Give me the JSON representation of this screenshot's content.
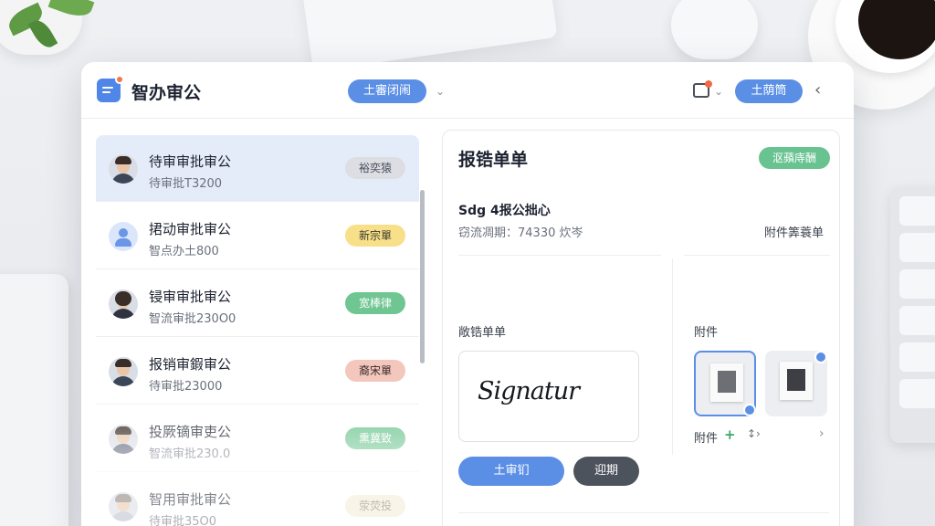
{
  "app": {
    "title": "智办审公",
    "header_pill": "土審闭闹",
    "action_button": "土荫筒"
  },
  "list": {
    "items": [
      {
        "title": "待审审批审公",
        "subtitle": "待审批T3200",
        "tag": "裕奕猿",
        "tag_bg": "#dcdee3",
        "tag_fg": "#4a505c",
        "avatar": "person-male-1"
      },
      {
        "title": "捃动审批审公",
        "subtitle": "智点办土800",
        "tag": "新宗單",
        "tag_bg": "#f8e08a",
        "tag_fg": "#3a3a2a",
        "avatar": "generic-user"
      },
      {
        "title": "锓审审批审公",
        "subtitle": "智流审批230O0",
        "tag": "宽棒律",
        "tag_bg": "#6fc692",
        "tag_fg": "#ffffff",
        "avatar": "person-female"
      },
      {
        "title": "报销审鍜审公",
        "subtitle": "待审批23000",
        "tag": "裔宋單",
        "tag_bg": "#f4c7bd",
        "tag_fg": "#3a2a2a",
        "avatar": "person-male-2"
      },
      {
        "title": "投厥镝审吏公",
        "subtitle": "智流审批230.0",
        "tag": "熏冀致",
        "tag_bg": "#6fc692",
        "tag_fg": "#ffffff",
        "avatar": "person-male-3"
      },
      {
        "title": "智用审批审公",
        "subtitle": "待审批35O0",
        "tag": "荥荧投",
        "tag_bg": "#f3ecd7",
        "tag_fg": "#8a8470",
        "avatar": "person-male-4"
      }
    ]
  },
  "detail": {
    "title": "报锆单单",
    "status": "沤蘋庤酬",
    "meta_line1": "Sdg 4报公拙心",
    "meta_line2": "窃流凋期：74330  炊岑",
    "meta_right": "附件筭蓑单",
    "signature_label": "敞锆单单",
    "signature_text": "Signatur",
    "attachments_label": "附件",
    "attachments_caption": "附件",
    "primary_button": "土审钔",
    "secondary_button": "迎期"
  },
  "icons": {
    "app": "app-icon",
    "notification": "bell-icon",
    "close": "close-icon"
  },
  "colors": {
    "accent": "#5b8fe6",
    "success": "#69c391",
    "active_row": "#e5ecf9"
  }
}
